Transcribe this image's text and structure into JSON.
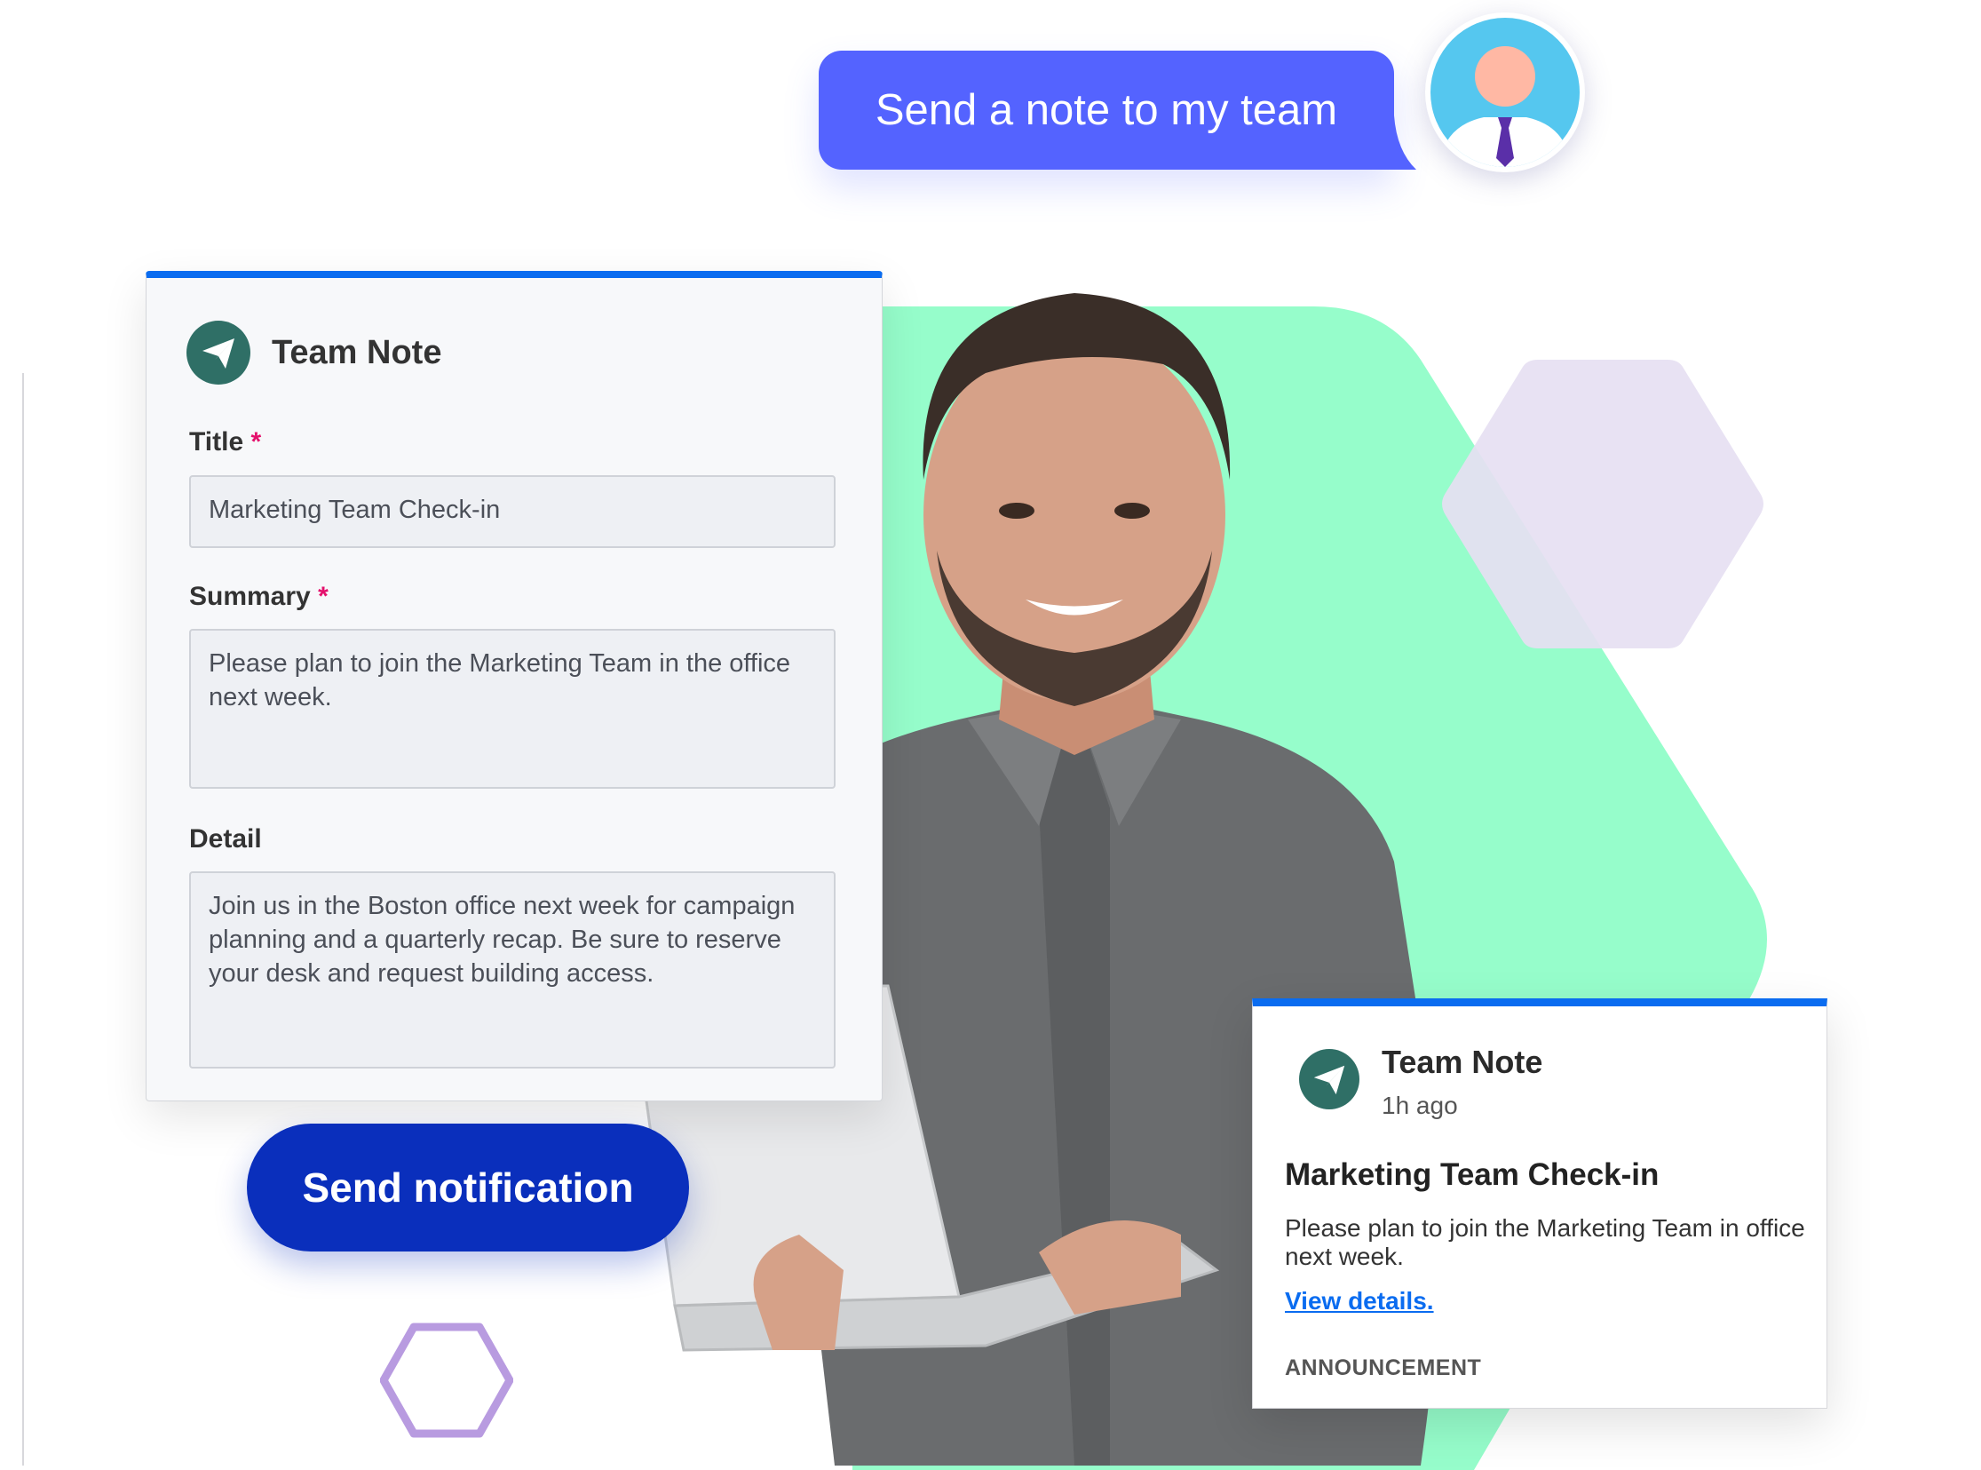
{
  "chat": {
    "message": "Send a note to my team",
    "avatar_icon": "user-avatar-icon"
  },
  "form": {
    "title": "Team Note",
    "fields": {
      "title_label": "Title",
      "title_value": "Marketing Team Check-in",
      "summary_label": "Summary",
      "summary_value": "Please plan to join the Marketing Team in the office next week.",
      "detail_label": "Detail",
      "detail_value": "Join us in the Boston office next week for campaign planning and a quarterly recap. Be sure to reserve your desk and request building access."
    },
    "required_marker": "*",
    "send_button": "Send notification"
  },
  "notification": {
    "app_name": "Team Note",
    "time": "1h ago",
    "heading": "Marketing Team Check-in",
    "body": "Please plan to join the Marketing Team in office next week.",
    "link": "View details.",
    "tag": "ANNOUNCEMENT"
  },
  "colors": {
    "accent_blue": "#0a6cf0",
    "bubble": "#5463ff",
    "button": "#0a2fbc",
    "blob_green": "#96fdcb",
    "hex_purple": "#e6dff2",
    "brand_icon": "#2f6f66",
    "required": "#e4106c"
  }
}
